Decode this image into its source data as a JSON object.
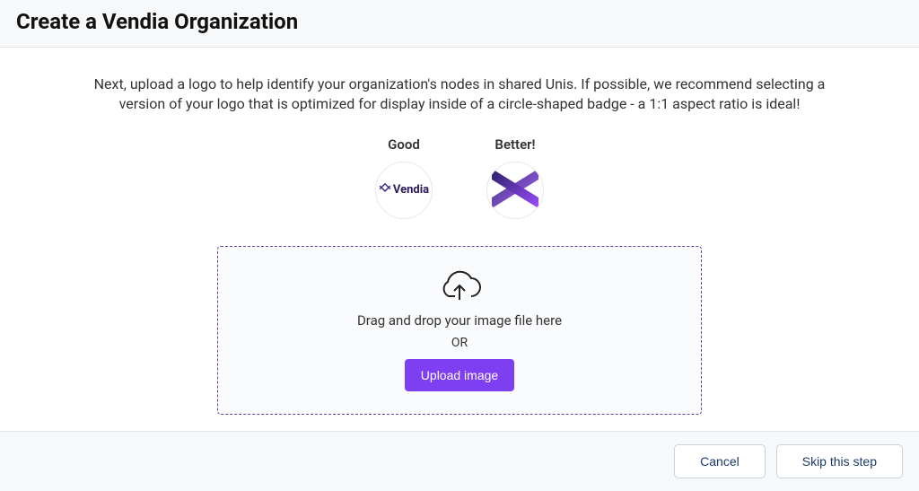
{
  "header": {
    "title": "Create a Vendia Organization"
  },
  "content": {
    "instructions": "Next, upload a logo to help identify your organization's nodes in shared Unis. If possible, we recommend selecting a version of your logo that is optimized for display inside of a circle-shaped badge - a 1:1 aspect ratio is ideal!",
    "examples": {
      "good": {
        "label": "Good",
        "badge_text": "Vendia"
      },
      "better": {
        "label": "Better!"
      }
    },
    "dropzone": {
      "drop_text": "Drag and drop your image file here",
      "or_text": "OR",
      "upload_button": "Upload image"
    }
  },
  "footer": {
    "cancel": "Cancel",
    "skip": "Skip this step"
  }
}
